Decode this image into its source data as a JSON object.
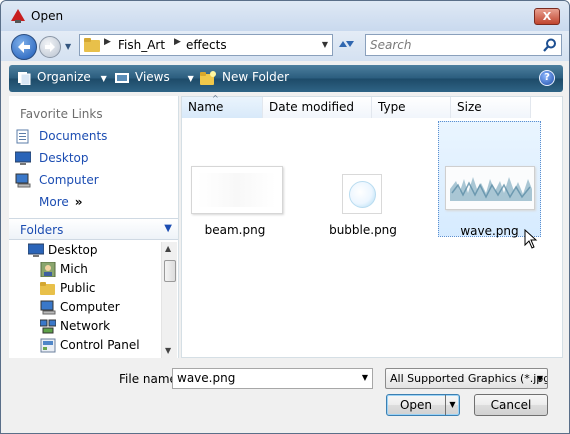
{
  "window": {
    "title": "Open",
    "close_label": "X"
  },
  "nav": {
    "breadcrumb": [
      "Fish_Art",
      "effects"
    ],
    "search_placeholder": "Search"
  },
  "toolbar": {
    "organize": "Organize",
    "views": "Views",
    "new_folder": "New Folder",
    "help": "?"
  },
  "sidebar": {
    "favorites_title": "Favorite Links",
    "favorites": [
      {
        "label": "Documents",
        "icon": "documents-icon"
      },
      {
        "label": "Desktop",
        "icon": "desktop-icon"
      },
      {
        "label": "Computer",
        "icon": "computer-icon"
      },
      {
        "label": "More",
        "icon": "more-icon"
      }
    ],
    "folders_title": "Folders",
    "tree": [
      {
        "label": "Desktop",
        "icon": "desktop-icon"
      },
      {
        "label": "Mich",
        "icon": "user-icon"
      },
      {
        "label": "Public",
        "icon": "folder-icon"
      },
      {
        "label": "Computer",
        "icon": "computer-icon"
      },
      {
        "label": "Network",
        "icon": "network-icon"
      },
      {
        "label": "Control Panel",
        "icon": "control-panel-icon"
      }
    ]
  },
  "filelist": {
    "columns": [
      "Name",
      "Date modified",
      "Type",
      "Size"
    ],
    "files": [
      {
        "name": "beam.png",
        "selected": false
      },
      {
        "name": "bubble.png",
        "selected": false
      },
      {
        "name": "wave.png",
        "selected": true
      }
    ]
  },
  "footer": {
    "filename_label": "File name:",
    "filename_value": "wave.png",
    "filter_value": "All Supported Graphics (*.jpg;",
    "open_label": "Open",
    "cancel_label": "Cancel"
  },
  "colors": {
    "toolbar": "#2a5c7d",
    "link": "#1c4db2",
    "selection": "#d6ebff"
  }
}
